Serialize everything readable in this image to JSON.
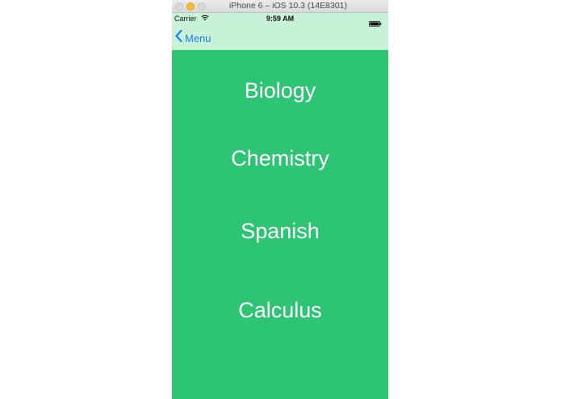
{
  "window": {
    "title": "iPhone 6 – iOS 10.3 (14E8301)"
  },
  "status_bar": {
    "carrier": "Carrier",
    "time": "9:59 AM",
    "wifi_icon": "wifi-icon",
    "battery_icon": "battery-icon"
  },
  "nav": {
    "back_label": "Menu",
    "back_icon": "chevron-left-icon"
  },
  "colors": {
    "background": "#2dc574",
    "nav_bar": "#c8f2d6",
    "accent": "#1a7cf5",
    "subject_text": "#ffffff"
  },
  "subjects": [
    {
      "label": "Biology"
    },
    {
      "label": "Chemistry"
    },
    {
      "label": "Spanish"
    },
    {
      "label": "Calculus"
    }
  ]
}
